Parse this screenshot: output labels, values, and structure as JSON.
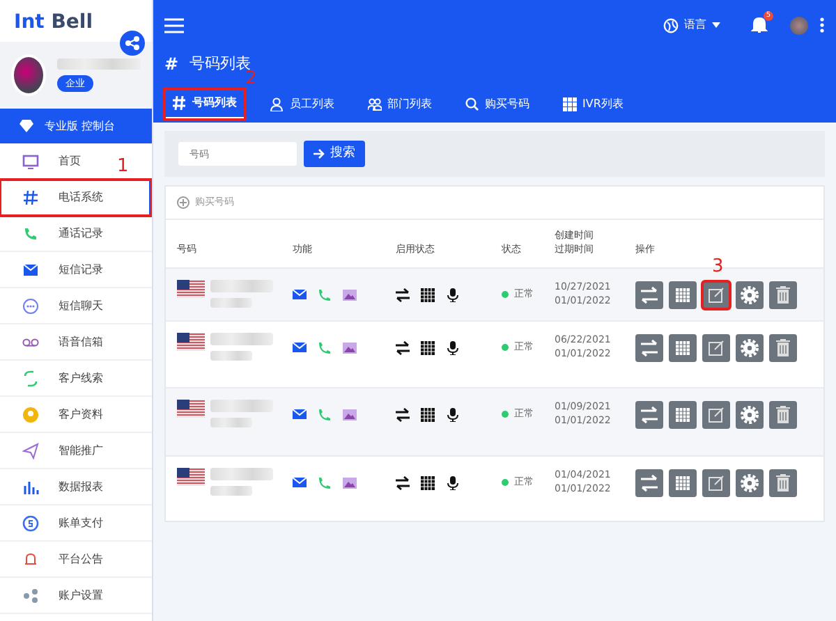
{
  "sidebar": {
    "logo": {
      "part_1": "Int",
      "part_2": "Bell"
    },
    "profile": {
      "badge": "企业"
    },
    "banner": "专业版 控制台",
    "items": [
      {
        "label": "首页",
        "selected": false,
        "color": "#8a63d2"
      },
      {
        "label": "电话系统",
        "selected": true,
        "color": "#1a56f0",
        "annotation": "1"
      },
      {
        "label": "通话记录",
        "selected": false,
        "color": "#2ecc71"
      },
      {
        "label": "短信记录",
        "selected": false,
        "color": "#1a56f0"
      },
      {
        "label": "短信聊天",
        "selected": false,
        "color": "#6f7ff0"
      },
      {
        "label": "语音信箱",
        "selected": false,
        "color": "#9b59b6"
      },
      {
        "label": "客户线索",
        "selected": false,
        "color": "#2ecc71"
      },
      {
        "label": "客户资料",
        "selected": false,
        "color": "#f1b50e"
      },
      {
        "label": "智能推广",
        "selected": false,
        "color": "#9b6bd6"
      },
      {
        "label": "数据报表",
        "selected": false,
        "color": "#1a56f0"
      },
      {
        "label": "账单支付",
        "selected": false,
        "color": "#3a6df0"
      },
      {
        "label": "平台公告",
        "selected": false,
        "color": "#e74c3c"
      },
      {
        "label": "账户设置",
        "selected": false,
        "color": "#8899aa"
      }
    ]
  },
  "topbar": {
    "language": "语言",
    "notification_count": "5"
  },
  "page_title": {
    "icon": "#",
    "text": "号码列表"
  },
  "tabs": [
    {
      "label": "号码列表",
      "selected": true,
      "annotation": "2"
    },
    {
      "label": "员工列表",
      "selected": false
    },
    {
      "label": "部门列表",
      "selected": false
    },
    {
      "label": "购买号码",
      "selected": false
    },
    {
      "label": "IVR列表",
      "selected": false
    }
  ],
  "search": {
    "placeholder": "号码",
    "button": "搜索"
  },
  "card": {
    "action": "购买号码",
    "columns": [
      "号码",
      "功能",
      "启用状态",
      "状态",
      [
        "创建时间",
        "过期时间"
      ],
      "操作"
    ],
    "rows": [
      {
        "status": "正常",
        "created": "10/27/2021",
        "expires": "01/01/2022",
        "annotation": "3"
      },
      {
        "status": "正常",
        "created": "06/22/2021",
        "expires": "01/01/2022"
      },
      {
        "status": "正常",
        "created": "01/09/2021",
        "expires": "01/01/2022"
      },
      {
        "status": "正常",
        "created": "01/04/2021",
        "expires": "01/01/2022"
      }
    ]
  }
}
